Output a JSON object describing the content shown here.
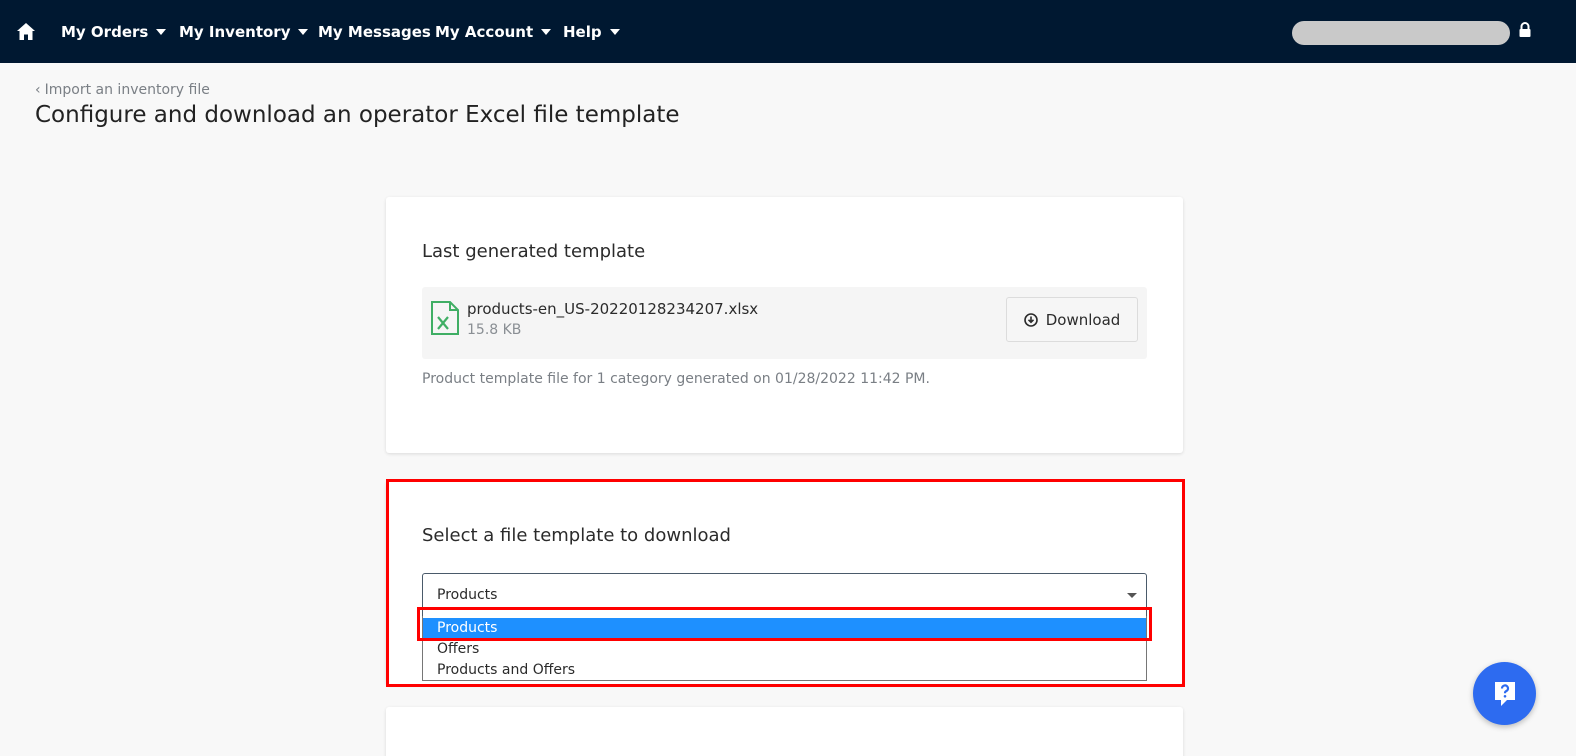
{
  "nav": {
    "items": [
      {
        "label": "My Orders",
        "has_caret": true
      },
      {
        "label": "My Inventory",
        "has_caret": true
      },
      {
        "label": "My Messages",
        "has_caret": false
      },
      {
        "label": "My Account",
        "has_caret": true
      },
      {
        "label": "Help",
        "has_caret": true
      }
    ],
    "icons": {
      "home": "home-icon",
      "lock": "lock-icon"
    },
    "background": "#001831"
  },
  "header": {
    "back_link": "Import an inventory file",
    "title": "Configure and download an operator Excel file template"
  },
  "last_template": {
    "title": "Last generated template",
    "file_name": "products-en_US-20220128234207.xlsx",
    "file_size": "15.8 KB",
    "download_label": "Download",
    "note": "Product template file for 1 category generated on 01/28/2022 11:42 PM."
  },
  "select_template": {
    "title": "Select a file template to download",
    "selected_value": "Products",
    "options": [
      "Products",
      "Offers",
      "Products and Offers"
    ],
    "highlighted_index": 0
  },
  "colors": {
    "accent": "#1e90ff",
    "annotation": "#ff0000",
    "help_button": "#2d6bf0",
    "excel_green": "#3fae64"
  }
}
